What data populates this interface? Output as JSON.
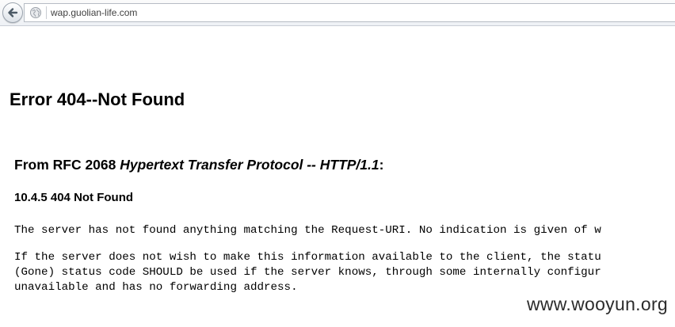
{
  "browser": {
    "url": "wap.guolian-life.com"
  },
  "page": {
    "title": "Error 404--Not Found",
    "rfc_prefix": "From RFC 2068 ",
    "rfc_title": "Hypertext Transfer Protocol -- HTTP/1.1",
    "rfc_suffix": ":",
    "section": "10.4.5 404 Not Found",
    "paragraph1": "The server has not found anything matching the Request-URI. No indication is given of w",
    "paragraph2_lines": [
      "If the server does not wish to make this information available to the client, the statu",
      "(Gone) status code SHOULD be used if the server knows, through some internally configur",
      "unavailable and has no forwarding address."
    ]
  },
  "watermark": "www.wooyun.org",
  "icons": {
    "back": "back-arrow-icon",
    "site": "globe-icon"
  },
  "colors": {
    "toolbar_bg": "#eef1f5",
    "url_text": "#404040",
    "back_arrow": "#4d5a66"
  }
}
